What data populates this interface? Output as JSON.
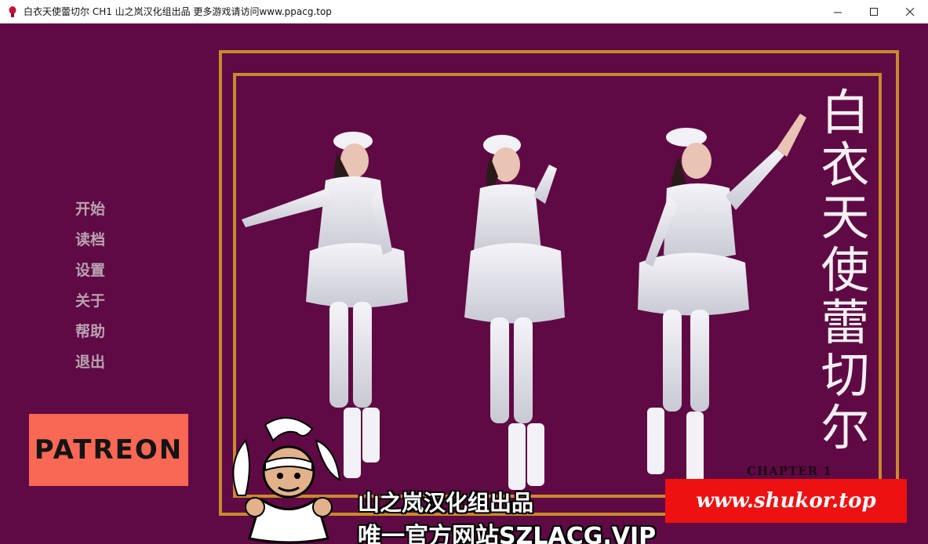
{
  "window": {
    "title": "白衣天使蕾切尔 CH1 山之岚汉化组出品 更多游戏请访问www.ppacg.top",
    "minimize_icon": "minimize-icon",
    "maximize_icon": "maximize-icon",
    "close_icon": "close-icon"
  },
  "menu": {
    "items": [
      "开始",
      "读档",
      "设置",
      "关于",
      "帮助",
      "退出"
    ]
  },
  "patreon": {
    "label": "PATREON",
    "color": "#f96854"
  },
  "game_title": {
    "chars": [
      "白",
      "衣",
      "天",
      "使",
      "蕾",
      "切",
      "尔"
    ]
  },
  "chapter": "CHAPTER 1",
  "watermark": {
    "site": "www.shukor.top",
    "credit_line1": "山之岚汉化组出品",
    "credit_line2": "唯一官方网站SZLACG.VIP",
    "logo_icon": "mascot-logo"
  },
  "colors": {
    "background": "#5f0a44",
    "frame": "#c98a2a",
    "menu_text": "#b9a3b0",
    "banner": "#ee1111"
  }
}
